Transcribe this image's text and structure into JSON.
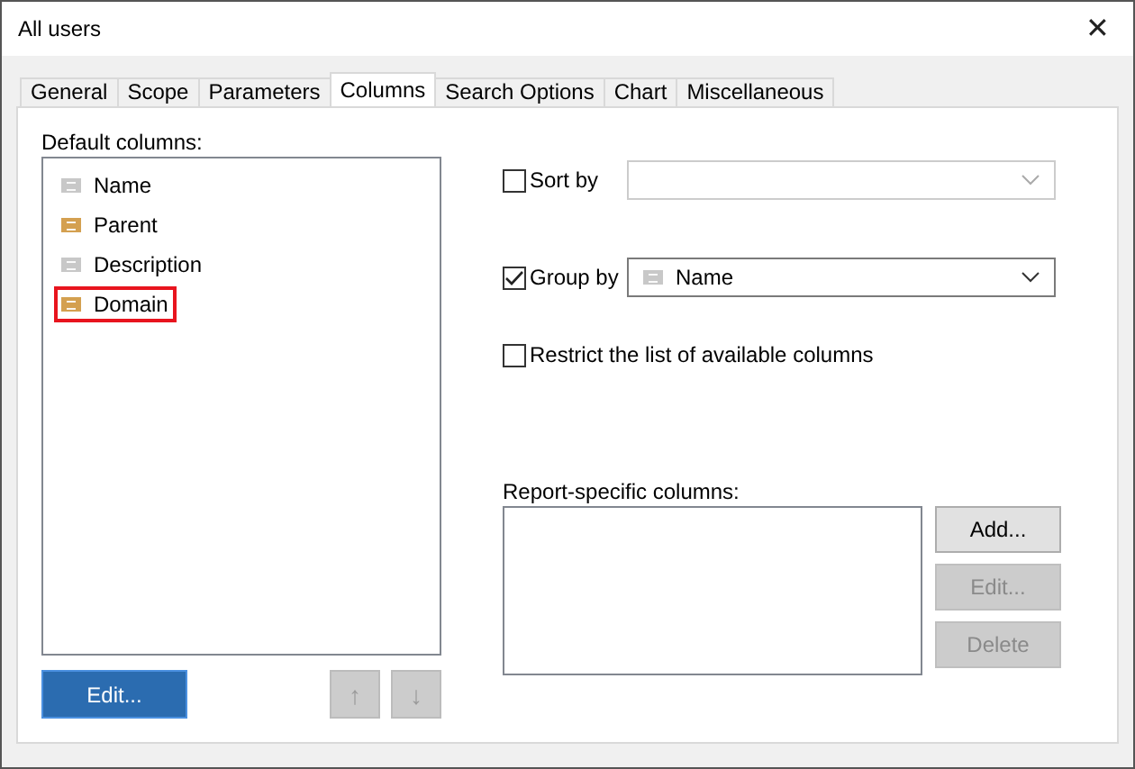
{
  "window": {
    "title": "All users",
    "close": "✕"
  },
  "tabs": [
    {
      "label": "General",
      "selected": false
    },
    {
      "label": "Scope",
      "selected": false
    },
    {
      "label": "Parameters",
      "selected": false
    },
    {
      "label": "Columns",
      "selected": true
    },
    {
      "label": "Search Options",
      "selected": false
    },
    {
      "label": "Chart",
      "selected": false
    },
    {
      "label": "Miscellaneous",
      "selected": false
    }
  ],
  "default_columns": {
    "label": "Default columns:",
    "items": [
      {
        "name": "Name",
        "color": "#c8c8c8",
        "highlighted": false
      },
      {
        "name": "Parent",
        "color": "#d4a050",
        "highlighted": false
      },
      {
        "name": "Description",
        "color": "#c8c8c8",
        "highlighted": false
      },
      {
        "name": "Domain",
        "color": "#d4a050",
        "highlighted": true
      }
    ],
    "edit_button": {
      "label": "Edit...",
      "disabled": false
    },
    "move_up": {
      "label": "↑",
      "disabled": true
    },
    "move_down": {
      "label": "↓",
      "disabled": true
    }
  },
  "sort_by": {
    "label": "Sort by",
    "checked": false
  },
  "group_by": {
    "label": "Group by",
    "checked": true,
    "value": {
      "name": "Name",
      "color": "#c8c8c8"
    }
  },
  "restrict": {
    "label": "Restrict the list of available columns",
    "checked": false
  },
  "report_columns": {
    "label": "Report-specific columns:",
    "buttons": [
      {
        "label": "Add...",
        "disabled": false
      },
      {
        "label": "Edit...",
        "disabled": true
      },
      {
        "label": "Delete",
        "disabled": true
      }
    ]
  }
}
